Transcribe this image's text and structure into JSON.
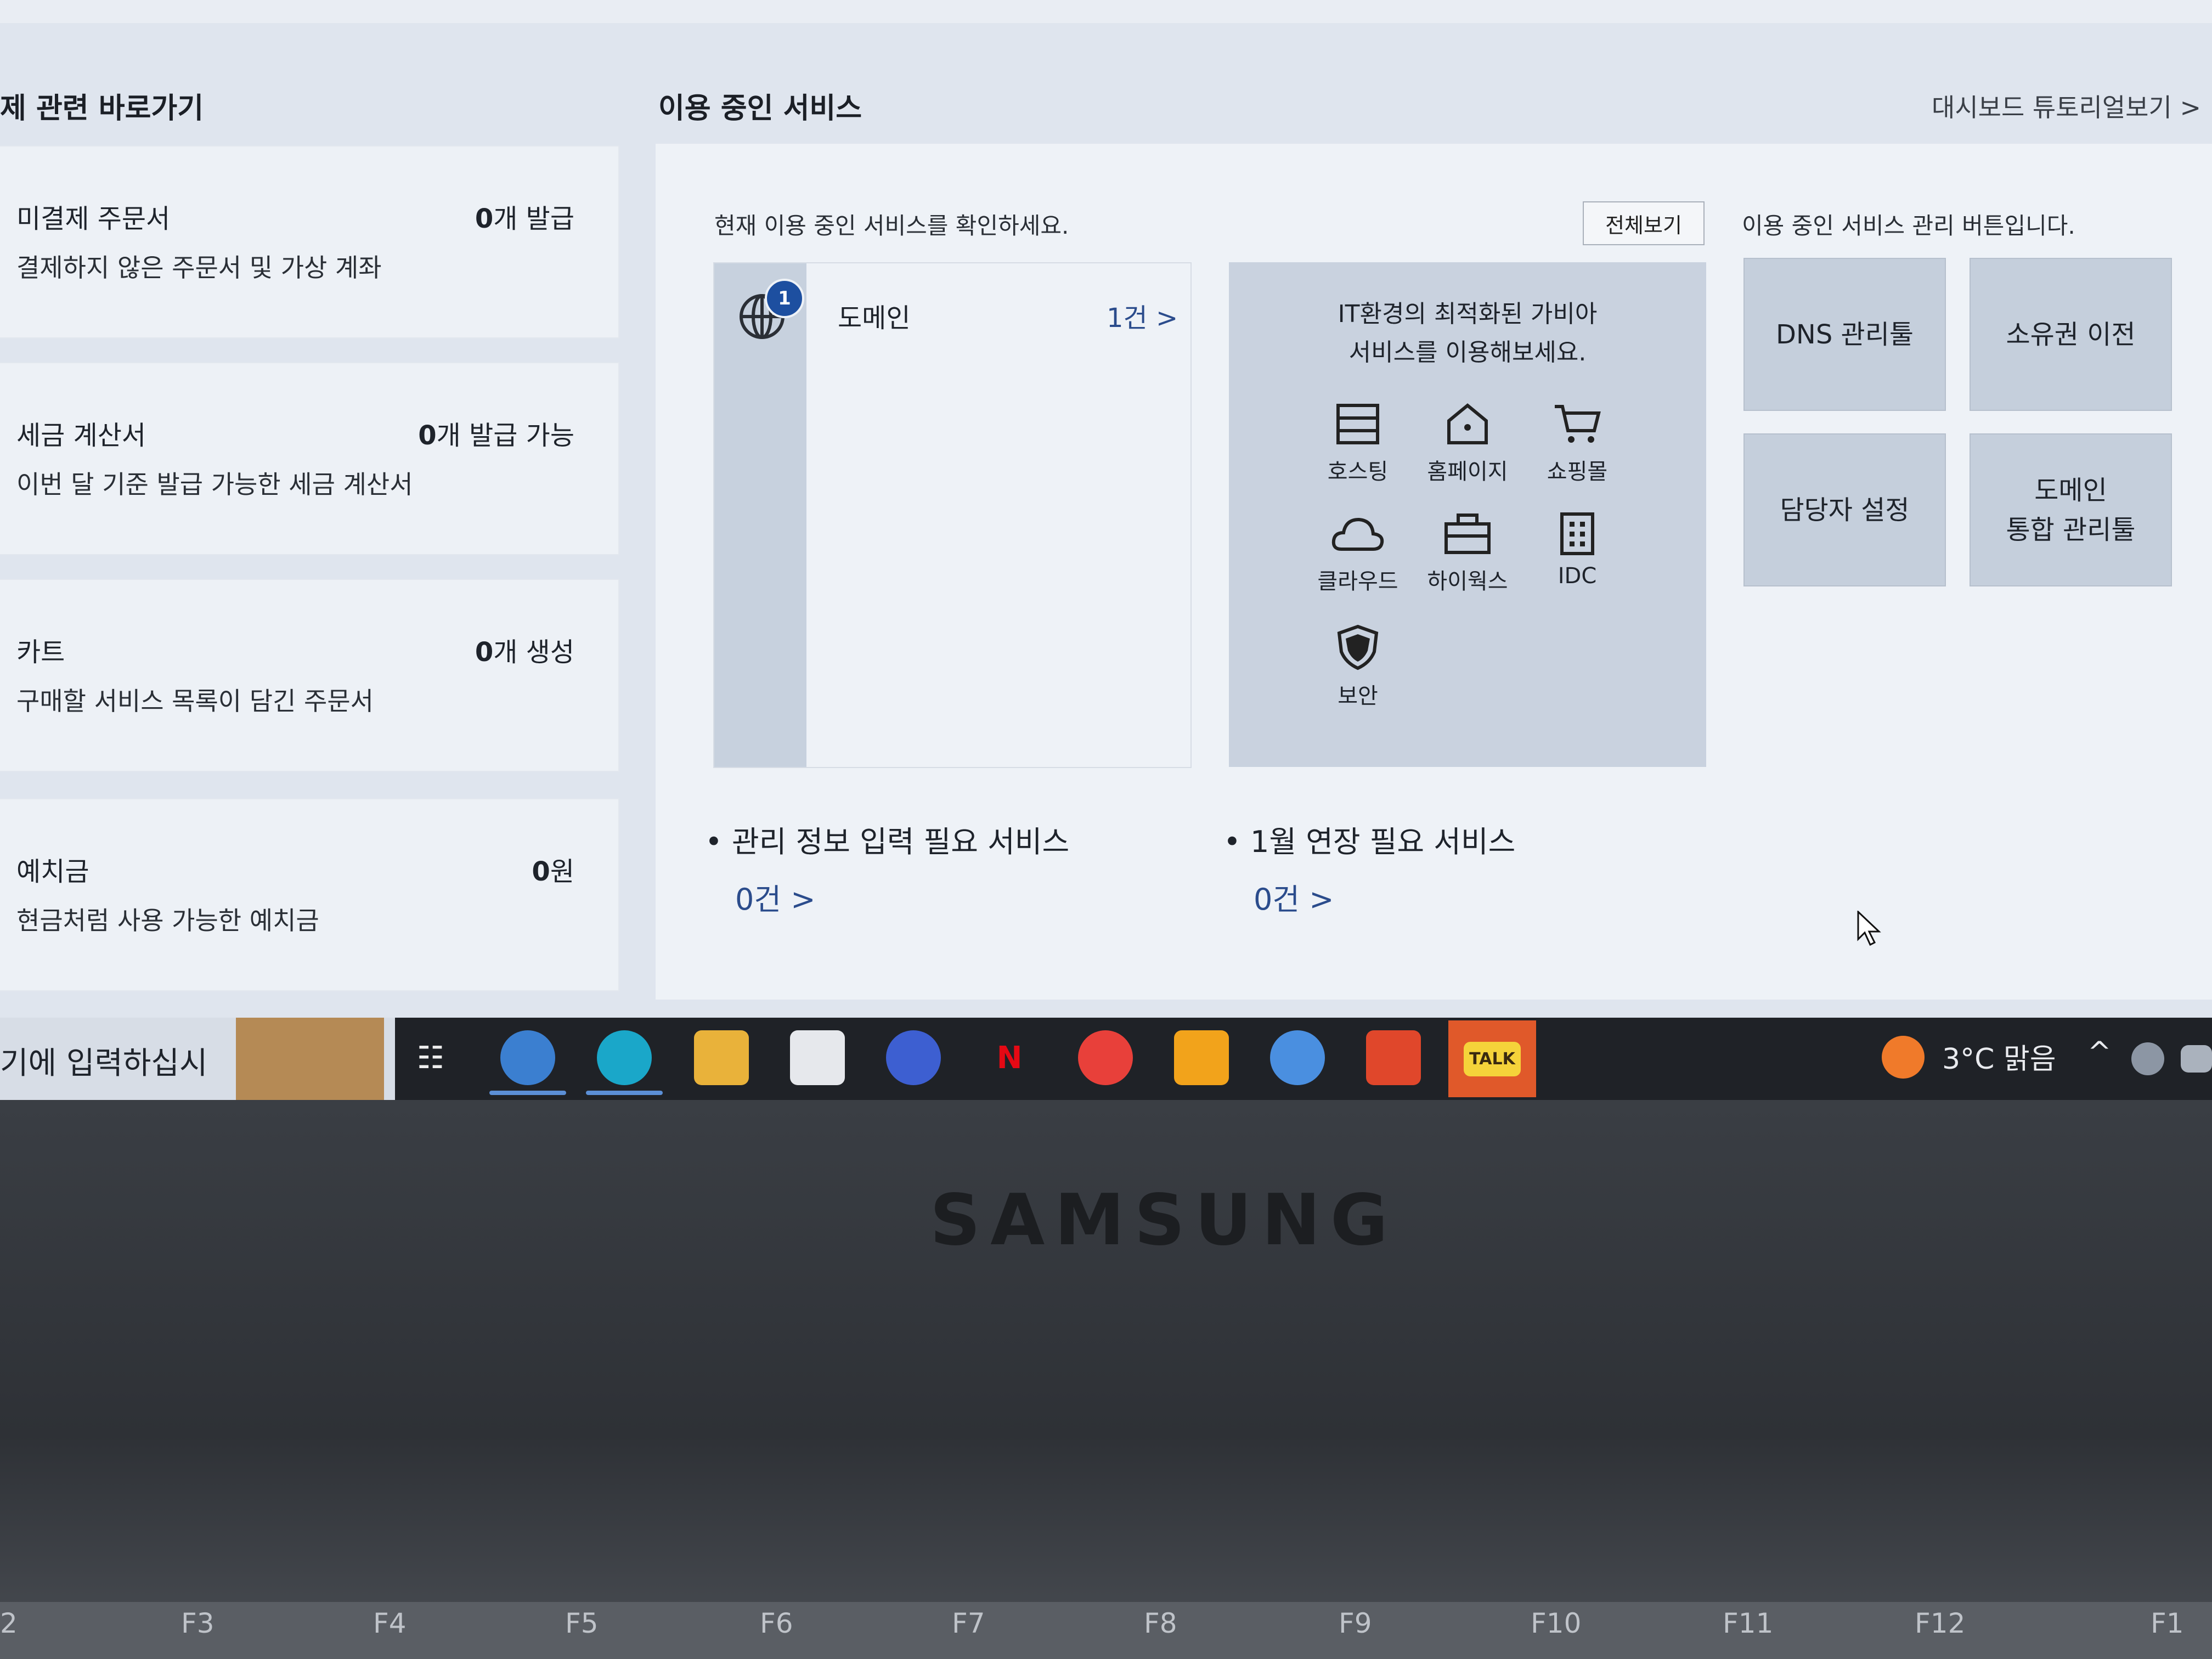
{
  "left_section": {
    "title": "제 관련 바로가기",
    "cards": [
      {
        "title": "미결제 주문서",
        "count_bold": "0",
        "count_rest": "개 발급",
        "desc": "결제하지 않은 주문서 및 가상 계좌"
      },
      {
        "title": "세금 계산서",
        "count_bold": "0",
        "count_rest": "개 발급 가능",
        "desc": "이번 달 기준 발급 가능한 세금 계산서"
      },
      {
        "title": "카트",
        "count_bold": "0",
        "count_rest": "개 생성",
        "desc": "구매할 서비스 목록이 담긴 주문서"
      },
      {
        "title": "예치금",
        "count_bold": "0",
        "count_rest": "원",
        "desc": "현금처럼 사용 가능한 예치금"
      }
    ]
  },
  "services": {
    "title": "이용 중인 서비스",
    "tutorial_link": "대시보드 튜토리얼보기 >",
    "desc": "현재 이용 중인 서비스를 확인하세요.",
    "view_all": "전체보기",
    "domain": {
      "label": "도메인",
      "count": "1건 >",
      "badge": "1"
    },
    "promo_line1": "IT환경의 최적화된 가비아",
    "promo_line2": "서비스를 이용해보세요.",
    "promo_items": [
      {
        "label": "호스팅",
        "icon": "server-icon"
      },
      {
        "label": "홈페이지",
        "icon": "home-icon"
      },
      {
        "label": "쇼핑몰",
        "icon": "cart-icon"
      },
      {
        "label": "클라우드",
        "icon": "cloud-icon"
      },
      {
        "label": "하이웍스",
        "icon": "briefcase-icon"
      },
      {
        "label": "IDC",
        "icon": "building-icon"
      },
      {
        "label": "보안",
        "icon": "shield-icon"
      }
    ],
    "mgmt_desc": "이용 중인 서비스 관리 버튼입니다.",
    "mgmt_buttons": [
      {
        "label": "DNS 관리툴"
      },
      {
        "label": "소유권 이전"
      },
      {
        "label": "담당자 설정"
      },
      {
        "label_line1": "도메인",
        "label_line2": "통합 관리툴"
      }
    ],
    "needs_info": {
      "label": "관리 정보 입력 필요 서비스",
      "count": "0건 >"
    },
    "renewal": {
      "label": "1월 연장 필요 서비스",
      "count": "0건 >"
    }
  },
  "taskbar": {
    "search_text": "기에 입력하십시",
    "weather": "3°C 맑음",
    "icons": [
      "task-view-icon",
      "app-icon",
      "edge-icon",
      "file-explorer-icon",
      "store-icon",
      "copilot-icon",
      "netflix-icon",
      "app-red-icon",
      "sticky-notes-icon",
      "chrome-icon",
      "brave-icon",
      "kakaotalk-icon"
    ],
    "kakao_label": "TALK",
    "netflix_label": "N"
  },
  "laptop": {
    "brand": "SAMSUNG",
    "fkeys": [
      "2",
      "F3",
      "F4",
      "F5",
      "F6",
      "F7",
      "F8",
      "F9",
      "F10",
      "F11",
      "F12",
      "F1"
    ]
  }
}
